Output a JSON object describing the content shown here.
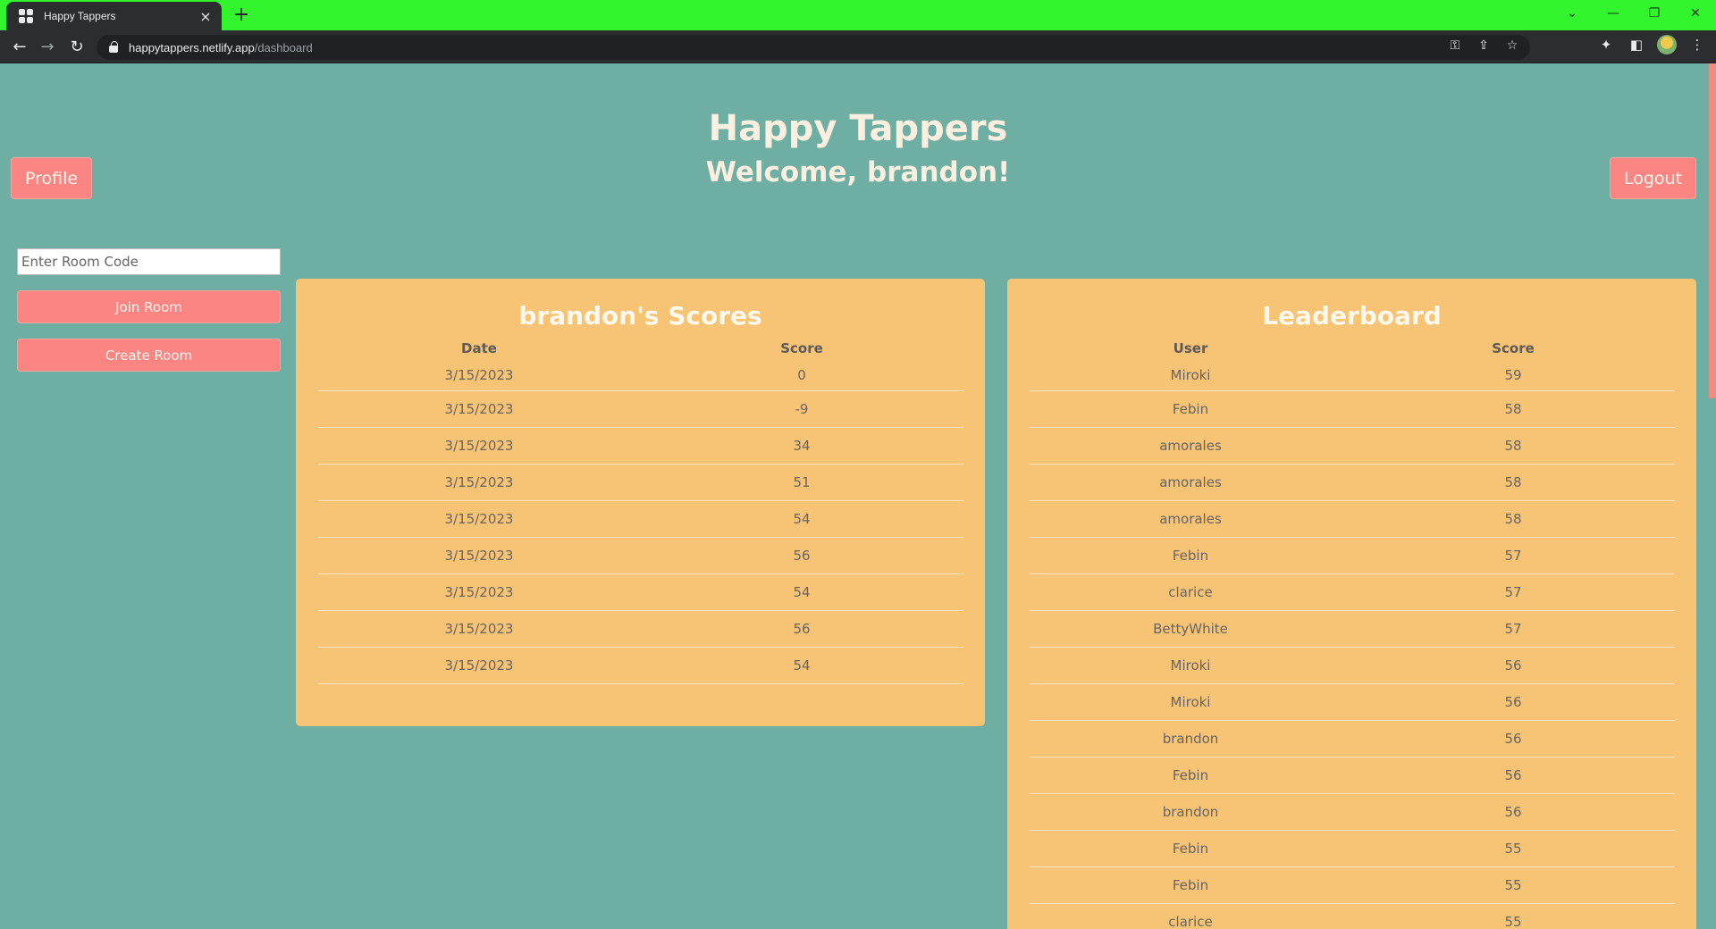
{
  "browser": {
    "tab_title": "Happy Tappers",
    "tab_close": "×",
    "new_tab": "+",
    "url_host": "happytappers.netlify.app",
    "url_path": "/dashboard",
    "window_controls": [
      "⌄",
      "—",
      "❐",
      "✕"
    ]
  },
  "header": {
    "title": "Happy Tappers",
    "welcome": "Welcome, brandon!",
    "profile_label": "Profile",
    "logout_label": "Logout"
  },
  "room": {
    "placeholder": "Enter Room Code",
    "join_label": "Join Room",
    "create_label": "Create Room"
  },
  "scores": {
    "title": "brandon's Scores",
    "columns": [
      "Date",
      "Score"
    ],
    "rows": [
      [
        "3/15/2023",
        "0"
      ],
      [
        "3/15/2023",
        "-9"
      ],
      [
        "3/15/2023",
        "34"
      ],
      [
        "3/15/2023",
        "51"
      ],
      [
        "3/15/2023",
        "54"
      ],
      [
        "3/15/2023",
        "56"
      ],
      [
        "3/15/2023",
        "54"
      ],
      [
        "3/15/2023",
        "56"
      ],
      [
        "3/15/2023",
        "54"
      ]
    ]
  },
  "leaderboard": {
    "title": "Leaderboard",
    "columns": [
      "User",
      "Score"
    ],
    "rows": [
      [
        "Miroki",
        "59"
      ],
      [
        "Febin",
        "58"
      ],
      [
        "amorales",
        "58"
      ],
      [
        "amorales",
        "58"
      ],
      [
        "amorales",
        "58"
      ],
      [
        "Febin",
        "57"
      ],
      [
        "clarice",
        "57"
      ],
      [
        "BettyWhite",
        "57"
      ],
      [
        "Miroki",
        "56"
      ],
      [
        "Miroki",
        "56"
      ],
      [
        "brandon",
        "56"
      ],
      [
        "Febin",
        "56"
      ],
      [
        "brandon",
        "56"
      ],
      [
        "Febin",
        "55"
      ],
      [
        "Febin",
        "55"
      ],
      [
        "clarice",
        "55"
      ]
    ]
  },
  "colors": {
    "background": "#6fafa3",
    "card": "#f7c375",
    "button": "#fb8583",
    "tabbar": "#33f52e"
  }
}
